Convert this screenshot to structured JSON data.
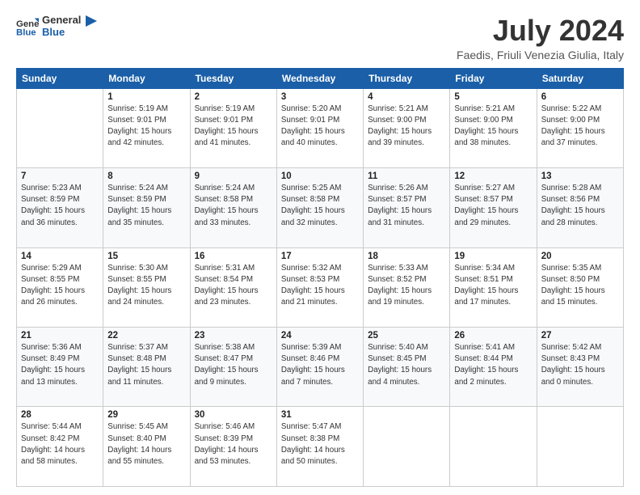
{
  "header": {
    "logo_line1": "General",
    "logo_line2": "Blue",
    "month": "July 2024",
    "location": "Faedis, Friuli Venezia Giulia, Italy"
  },
  "columns": [
    "Sunday",
    "Monday",
    "Tuesday",
    "Wednesday",
    "Thursday",
    "Friday",
    "Saturday"
  ],
  "weeks": [
    [
      {
        "day": "",
        "sunrise": "",
        "sunset": "",
        "daylight": ""
      },
      {
        "day": "1",
        "sunrise": "Sunrise: 5:19 AM",
        "sunset": "Sunset: 9:01 PM",
        "daylight": "Daylight: 15 hours and 42 minutes."
      },
      {
        "day": "2",
        "sunrise": "Sunrise: 5:19 AM",
        "sunset": "Sunset: 9:01 PM",
        "daylight": "Daylight: 15 hours and 41 minutes."
      },
      {
        "day": "3",
        "sunrise": "Sunrise: 5:20 AM",
        "sunset": "Sunset: 9:01 PM",
        "daylight": "Daylight: 15 hours and 40 minutes."
      },
      {
        "day": "4",
        "sunrise": "Sunrise: 5:21 AM",
        "sunset": "Sunset: 9:00 PM",
        "daylight": "Daylight: 15 hours and 39 minutes."
      },
      {
        "day": "5",
        "sunrise": "Sunrise: 5:21 AM",
        "sunset": "Sunset: 9:00 PM",
        "daylight": "Daylight: 15 hours and 38 minutes."
      },
      {
        "day": "6",
        "sunrise": "Sunrise: 5:22 AM",
        "sunset": "Sunset: 9:00 PM",
        "daylight": "Daylight: 15 hours and 37 minutes."
      }
    ],
    [
      {
        "day": "7",
        "sunrise": "Sunrise: 5:23 AM",
        "sunset": "Sunset: 8:59 PM",
        "daylight": "Daylight: 15 hours and 36 minutes."
      },
      {
        "day": "8",
        "sunrise": "Sunrise: 5:24 AM",
        "sunset": "Sunset: 8:59 PM",
        "daylight": "Daylight: 15 hours and 35 minutes."
      },
      {
        "day": "9",
        "sunrise": "Sunrise: 5:24 AM",
        "sunset": "Sunset: 8:58 PM",
        "daylight": "Daylight: 15 hours and 33 minutes."
      },
      {
        "day": "10",
        "sunrise": "Sunrise: 5:25 AM",
        "sunset": "Sunset: 8:58 PM",
        "daylight": "Daylight: 15 hours and 32 minutes."
      },
      {
        "day": "11",
        "sunrise": "Sunrise: 5:26 AM",
        "sunset": "Sunset: 8:57 PM",
        "daylight": "Daylight: 15 hours and 31 minutes."
      },
      {
        "day": "12",
        "sunrise": "Sunrise: 5:27 AM",
        "sunset": "Sunset: 8:57 PM",
        "daylight": "Daylight: 15 hours and 29 minutes."
      },
      {
        "day": "13",
        "sunrise": "Sunrise: 5:28 AM",
        "sunset": "Sunset: 8:56 PM",
        "daylight": "Daylight: 15 hours and 28 minutes."
      }
    ],
    [
      {
        "day": "14",
        "sunrise": "Sunrise: 5:29 AM",
        "sunset": "Sunset: 8:55 PM",
        "daylight": "Daylight: 15 hours and 26 minutes."
      },
      {
        "day": "15",
        "sunrise": "Sunrise: 5:30 AM",
        "sunset": "Sunset: 8:55 PM",
        "daylight": "Daylight: 15 hours and 24 minutes."
      },
      {
        "day": "16",
        "sunrise": "Sunrise: 5:31 AM",
        "sunset": "Sunset: 8:54 PM",
        "daylight": "Daylight: 15 hours and 23 minutes."
      },
      {
        "day": "17",
        "sunrise": "Sunrise: 5:32 AM",
        "sunset": "Sunset: 8:53 PM",
        "daylight": "Daylight: 15 hours and 21 minutes."
      },
      {
        "day": "18",
        "sunrise": "Sunrise: 5:33 AM",
        "sunset": "Sunset: 8:52 PM",
        "daylight": "Daylight: 15 hours and 19 minutes."
      },
      {
        "day": "19",
        "sunrise": "Sunrise: 5:34 AM",
        "sunset": "Sunset: 8:51 PM",
        "daylight": "Daylight: 15 hours and 17 minutes."
      },
      {
        "day": "20",
        "sunrise": "Sunrise: 5:35 AM",
        "sunset": "Sunset: 8:50 PM",
        "daylight": "Daylight: 15 hours and 15 minutes."
      }
    ],
    [
      {
        "day": "21",
        "sunrise": "Sunrise: 5:36 AM",
        "sunset": "Sunset: 8:49 PM",
        "daylight": "Daylight: 15 hours and 13 minutes."
      },
      {
        "day": "22",
        "sunrise": "Sunrise: 5:37 AM",
        "sunset": "Sunset: 8:48 PM",
        "daylight": "Daylight: 15 hours and 11 minutes."
      },
      {
        "day": "23",
        "sunrise": "Sunrise: 5:38 AM",
        "sunset": "Sunset: 8:47 PM",
        "daylight": "Daylight: 15 hours and 9 minutes."
      },
      {
        "day": "24",
        "sunrise": "Sunrise: 5:39 AM",
        "sunset": "Sunset: 8:46 PM",
        "daylight": "Daylight: 15 hours and 7 minutes."
      },
      {
        "day": "25",
        "sunrise": "Sunrise: 5:40 AM",
        "sunset": "Sunset: 8:45 PM",
        "daylight": "Daylight: 15 hours and 4 minutes."
      },
      {
        "day": "26",
        "sunrise": "Sunrise: 5:41 AM",
        "sunset": "Sunset: 8:44 PM",
        "daylight": "Daylight: 15 hours and 2 minutes."
      },
      {
        "day": "27",
        "sunrise": "Sunrise: 5:42 AM",
        "sunset": "Sunset: 8:43 PM",
        "daylight": "Daylight: 15 hours and 0 minutes."
      }
    ],
    [
      {
        "day": "28",
        "sunrise": "Sunrise: 5:44 AM",
        "sunset": "Sunset: 8:42 PM",
        "daylight": "Daylight: 14 hours and 58 minutes."
      },
      {
        "day": "29",
        "sunrise": "Sunrise: 5:45 AM",
        "sunset": "Sunset: 8:40 PM",
        "daylight": "Daylight: 14 hours and 55 minutes."
      },
      {
        "day": "30",
        "sunrise": "Sunrise: 5:46 AM",
        "sunset": "Sunset: 8:39 PM",
        "daylight": "Daylight: 14 hours and 53 minutes."
      },
      {
        "day": "31",
        "sunrise": "Sunrise: 5:47 AM",
        "sunset": "Sunset: 8:38 PM",
        "daylight": "Daylight: 14 hours and 50 minutes."
      },
      {
        "day": "",
        "sunrise": "",
        "sunset": "",
        "daylight": ""
      },
      {
        "day": "",
        "sunrise": "",
        "sunset": "",
        "daylight": ""
      },
      {
        "day": "",
        "sunrise": "",
        "sunset": "",
        "daylight": ""
      }
    ]
  ]
}
